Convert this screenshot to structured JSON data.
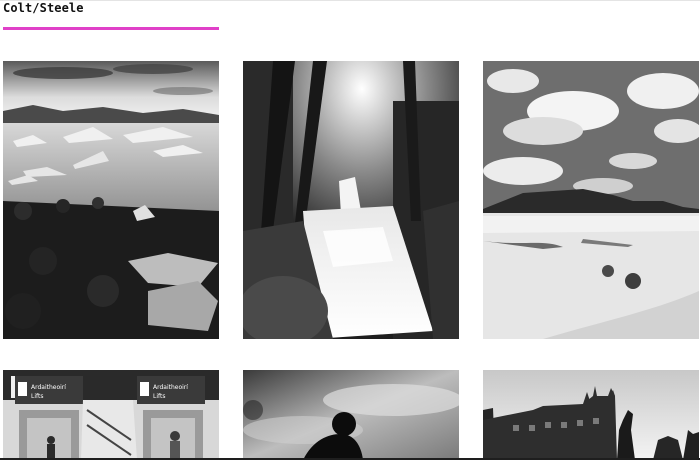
{
  "header": {
    "brand": "Colt/Steele"
  },
  "colors": {
    "accent": "#e040c8"
  },
  "gallery": {
    "photos": [
      {
        "name": "glacier-lagoon-photo",
        "signs": []
      },
      {
        "name": "forest-waterfall-photo",
        "signs": []
      },
      {
        "name": "desert-clouds-photo",
        "signs": []
      },
      {
        "name": "station-lifts-photo",
        "signs": [
          "Ardaitheoirí",
          "Lifts",
          "Ardaitheoirí",
          "Lifts"
        ]
      },
      {
        "name": "cyclist-silhouette-photo",
        "signs": []
      },
      {
        "name": "castle-skyline-photo",
        "signs": []
      }
    ]
  }
}
